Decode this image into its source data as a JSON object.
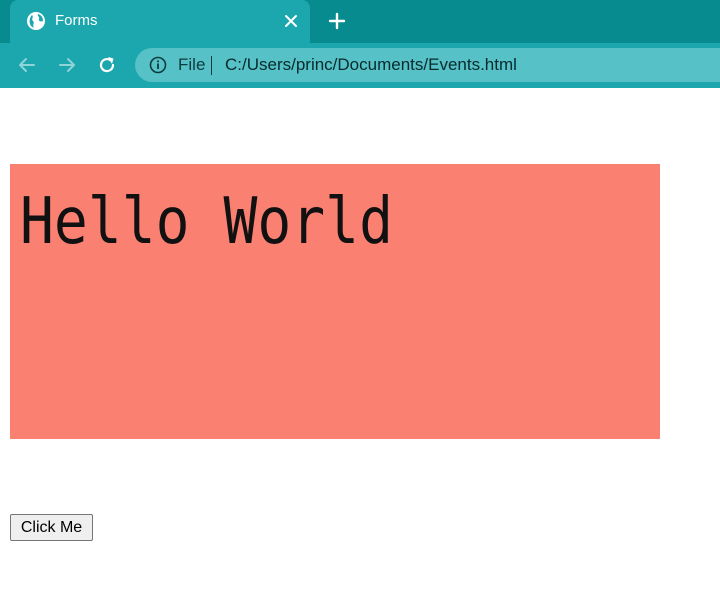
{
  "browser": {
    "tab": {
      "title": "Forms",
      "icon": "globe-icon",
      "close_icon": "close-icon"
    },
    "new_tab_icon": "plus-icon",
    "nav": {
      "back_icon": "back-arrow-icon",
      "forward_icon": "forward-arrow-icon",
      "reload_icon": "reload-icon"
    },
    "omnibox": {
      "info_icon": "info-icon",
      "scheme_label": "File",
      "url": "C:/Users/princ/Documents/Events.html"
    },
    "colors": {
      "titlebar": "#078b8f",
      "tab_and_toolbar": "#1ca6ad",
      "omnibox": "#56c1c6"
    }
  },
  "page": {
    "box": {
      "text": "Hello World",
      "background": "#fa8072"
    },
    "button": {
      "label": "Click Me"
    }
  }
}
